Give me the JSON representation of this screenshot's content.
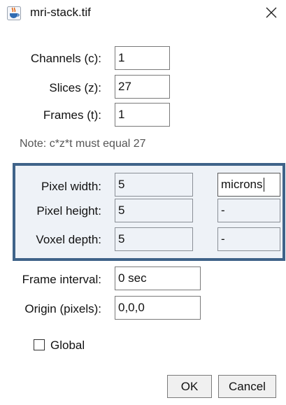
{
  "window": {
    "title": "mri-stack.tif",
    "app_icon": "java-cup-icon",
    "close_icon": "close-icon"
  },
  "dimensions": {
    "channels_label": "Channels (c):",
    "channels_value": "1",
    "slices_label": "Slices (z):",
    "slices_value": "27",
    "frames_label": "Frames (t):",
    "frames_value": "1",
    "note": "Note: c*z*t must equal 27"
  },
  "calibration": {
    "border_color": "#3f6389",
    "pixel_width_label": "Pixel width:",
    "pixel_width_value": "5",
    "pixel_width_unit": "microns",
    "pixel_height_label": "Pixel height:",
    "pixel_height_value": "5",
    "pixel_height_unit": "-",
    "voxel_depth_label": "Voxel depth:",
    "voxel_depth_value": "5",
    "voxel_depth_unit": "-"
  },
  "timing": {
    "frame_interval_label": "Frame interval:",
    "frame_interval_value": "0 sec",
    "origin_label": "Origin (pixels):",
    "origin_value": "0,0,0"
  },
  "global_checkbox": {
    "label": "Global",
    "checked": false
  },
  "buttons": {
    "ok_label": "OK",
    "cancel_label": "Cancel"
  }
}
